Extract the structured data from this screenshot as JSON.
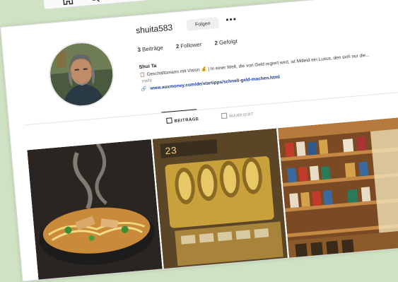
{
  "nav": {
    "home_icon": "home-icon",
    "search_icon": "search-icon"
  },
  "profile": {
    "username": "shuita583",
    "follow_label": "Folgen",
    "more_label": "•••",
    "stats": [
      {
        "count": "3",
        "label": "Beiträge"
      },
      {
        "count": "2",
        "label": "Follower"
      },
      {
        "count": "2",
        "label": "Gefolgt"
      }
    ],
    "full_name": "Shui Ta",
    "bio": "📋 Geschäftsmann mit Vision 💰 | In einer Welt, die von Geld regiert wird, ist Mitleid ein Luxus, den sich nur die...",
    "bio_more": "mehr",
    "link": "www.auxmoney.com/de/startipps/schnell-geld-machen.html"
  },
  "tabs": [
    {
      "label": "BEITRÄGE",
      "active": true
    },
    {
      "label": "MARKIERT",
      "active": false
    }
  ],
  "posts": [
    {
      "subject": "steaming noodle soup bowl"
    },
    {
      "subject": "golden cash register"
    },
    {
      "subject": "tobacco shop shelves"
    }
  ],
  "colors": {
    "background": "#cfe3c4",
    "link": "#1a3d8f",
    "gold": "#c9a13c"
  }
}
